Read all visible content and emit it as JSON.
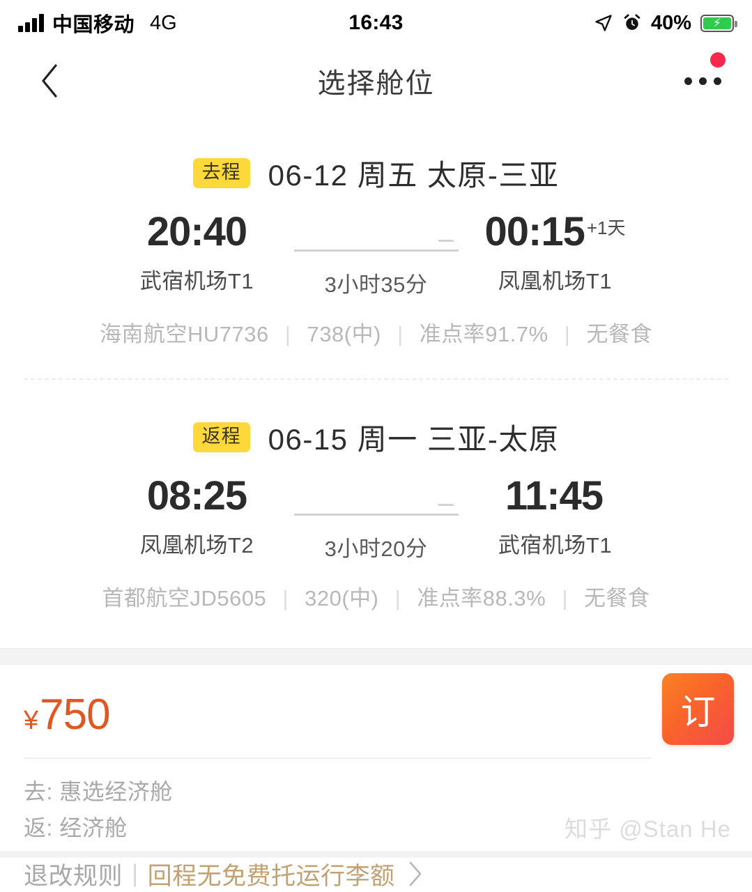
{
  "status_bar": {
    "carrier": "中国移动",
    "network": "4G",
    "time": "16:43",
    "battery_percent": "40%",
    "icons": [
      "signal-bars-icon",
      "location-arrow-icon",
      "alarm-clock-icon",
      "battery-charging-icon"
    ]
  },
  "nav": {
    "back_icon": "chevron-left-icon",
    "title": "选择舱位",
    "more_icon": "more-horizontal-icon",
    "badge_color": "#f8294c"
  },
  "flights": [
    {
      "badge": "去程",
      "title": "06-12 周五 太原-三亚",
      "depart_time": "20:40",
      "depart_airport": "武宿机场T1",
      "arrive_time": "00:15",
      "arrive_day_offset": "+1天",
      "arrive_airport": "凤凰机场T1",
      "duration": "3小时35分",
      "meta": {
        "airline": "海南航空HU7736",
        "aircraft": "738(中)",
        "punctuality": "准点率91.7%",
        "meal": "无餐食"
      }
    },
    {
      "badge": "返程",
      "title": "06-15 周一 三亚-太原",
      "depart_time": "08:25",
      "depart_airport": "凤凰机场T2",
      "arrive_time": "11:45",
      "arrive_day_offset": "",
      "arrive_airport": "武宿机场T1",
      "duration": "3小时20分",
      "meta": {
        "airline": "首都航空JD5605",
        "aircraft": "320(中)",
        "punctuality": "准点率88.3%",
        "meal": "无餐食"
      }
    }
  ],
  "footer": {
    "currency_symbol": "¥",
    "price": "750",
    "price_color": "#e2571f",
    "cabin_outbound": "去: 惠选经济舱",
    "cabin_return": "返: 经济舱",
    "rules_label": "退改规则",
    "rules_separator": "|",
    "baggage_hint": "回程无免费托运行李额",
    "baggage_hint_color": "#c2a273",
    "chevron_icon": "chevron-right-icon",
    "order_button": "订",
    "order_button_colors": [
      "#fb8124",
      "#f44a4a"
    ]
  },
  "watermark": "知乎 @Stan He",
  "meta_separator": "|"
}
